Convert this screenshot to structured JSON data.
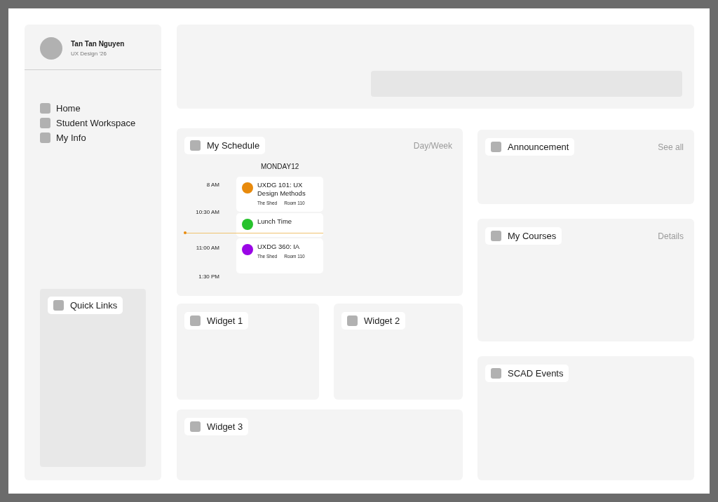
{
  "profile": {
    "name": "Tan Tan Nguyen",
    "subtitle": "UX Design '26"
  },
  "nav": [
    "Home",
    "Student Workspace",
    "My Info"
  ],
  "quick_links": {
    "title": "Quick Links"
  },
  "schedule": {
    "title": "My Schedule",
    "action": "Day/Week",
    "day": "MONDAY12",
    "times": [
      "8 AM",
      "10:30 AM",
      "11:00 AM",
      "1:30 PM"
    ],
    "events": [
      {
        "title": "UXDG 101: UX Design Methods",
        "place": "The Shed",
        "room": "Room 110",
        "color": "#e88a0c"
      },
      {
        "title": "Lunch Time",
        "color": "#27c22c"
      },
      {
        "title": "UXDG 360: IA",
        "place": "The Shed",
        "room": "Room 110",
        "color": "#9a05e6"
      }
    ]
  },
  "widgets": [
    "Widget 1",
    "Widget 2",
    "Widget 3"
  ],
  "panels": [
    {
      "title": "Announcement",
      "action": "See all"
    },
    {
      "title": "My Courses",
      "action": "Details"
    },
    {
      "title": "SCAD Events"
    }
  ]
}
